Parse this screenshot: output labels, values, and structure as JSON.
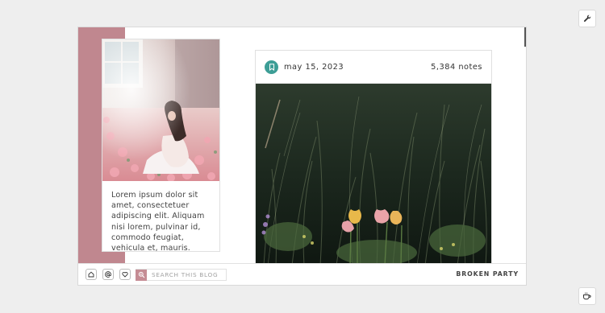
{
  "corner_buttons": {
    "top": {
      "icon": "wrench-icon"
    },
    "bottom": {
      "icon": "coffee-cup-icon"
    }
  },
  "sidebar": {
    "photo": {
      "description_icon": "woman-in-flower-field-photo"
    },
    "text": "Lorem ipsum dolor sit amet, consectetuer adipiscing elit. Aliquam nisi lorem, pulvinar id, commodo feugiat, vehicula et, mauris."
  },
  "post": {
    "icon": "bookmark-icon",
    "date": "may 15, 2023",
    "notes": "5,384 notes"
  },
  "bottom_bar": {
    "nav": [
      {
        "icon": "home-icon"
      },
      {
        "icon": "at-sign-icon"
      },
      {
        "icon": "heart-icon"
      }
    ],
    "search": {
      "icon": "search-icon",
      "placeholder": "SEARCH THIS BLOG"
    },
    "blog_title": "BROKEN PARTY"
  },
  "colors": {
    "accent": "#c0878f",
    "teal": "#3d9e96",
    "search_accent": "#c58c94"
  }
}
